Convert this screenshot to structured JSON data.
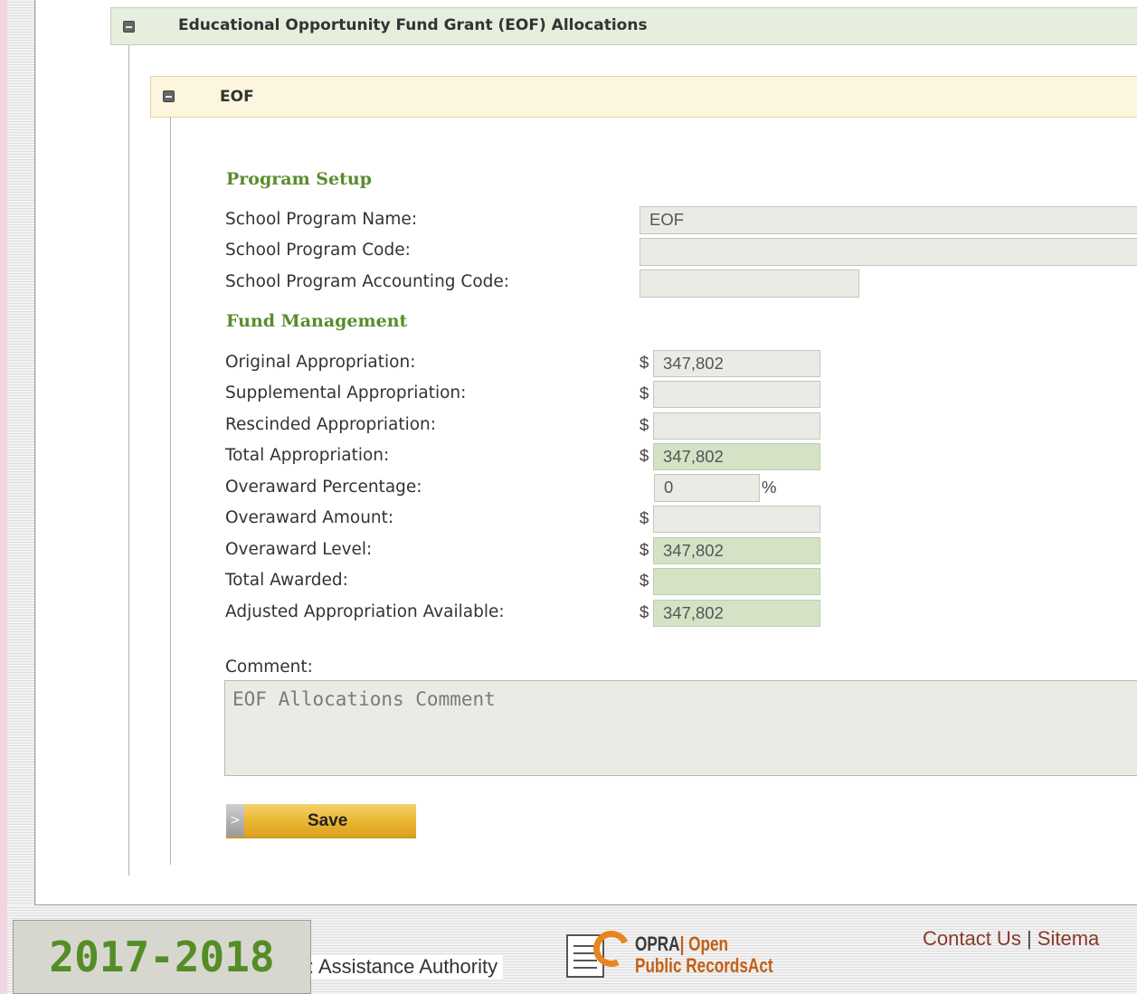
{
  "section": {
    "title": "Educational Opportunity Fund Grant (EOF) Allocations"
  },
  "subsection": {
    "title": "EOF"
  },
  "program_setup": {
    "heading": "Program Setup",
    "fields": [
      {
        "label": "School Program Name:",
        "value": "EOF"
      },
      {
        "label": "School Program Code:",
        "value": ""
      },
      {
        "label": "School Program Accounting Code:",
        "value": ""
      }
    ]
  },
  "fund_management": {
    "heading": "Fund Management",
    "currency_symbol": "$",
    "percent_symbol": "%",
    "fields": [
      {
        "label": "Original Appropriation:",
        "value": "347,802"
      },
      {
        "label": "Supplemental Appropriation:",
        "value": ""
      },
      {
        "label": "Rescinded Appropriation:",
        "value": ""
      },
      {
        "label": "Total Appropriation:",
        "value": "347,802"
      },
      {
        "label": "Overaward Percentage:",
        "value": "0"
      },
      {
        "label": "Overaward Amount:",
        "value": ""
      },
      {
        "label": "Overaward Level:",
        "value": "347,802"
      },
      {
        "label": "Total Awarded:",
        "value": ""
      },
      {
        "label": "Adjusted Appropriation Available:",
        "value": "347,802"
      }
    ]
  },
  "comment": {
    "label": "Comment:",
    "value": "EOF Allocations Comment"
  },
  "save_button": {
    "label": "Save",
    "arrow": ">"
  },
  "footer": {
    "year": "2017-2018",
    "org_text": ": Assistance Authority",
    "opra_line1_a": "OPRA",
    "opra_line1_b": "| Open",
    "opra_line2": "Public RecordsAct",
    "links": [
      "Contact Us",
      "Sitema"
    ],
    "separator": "|"
  },
  "colors": {
    "accent_green": "#5a8c2e",
    "computed_field": "#d4e2c5",
    "readonly_field": "#ebebe6",
    "save_button": "#eab530"
  }
}
